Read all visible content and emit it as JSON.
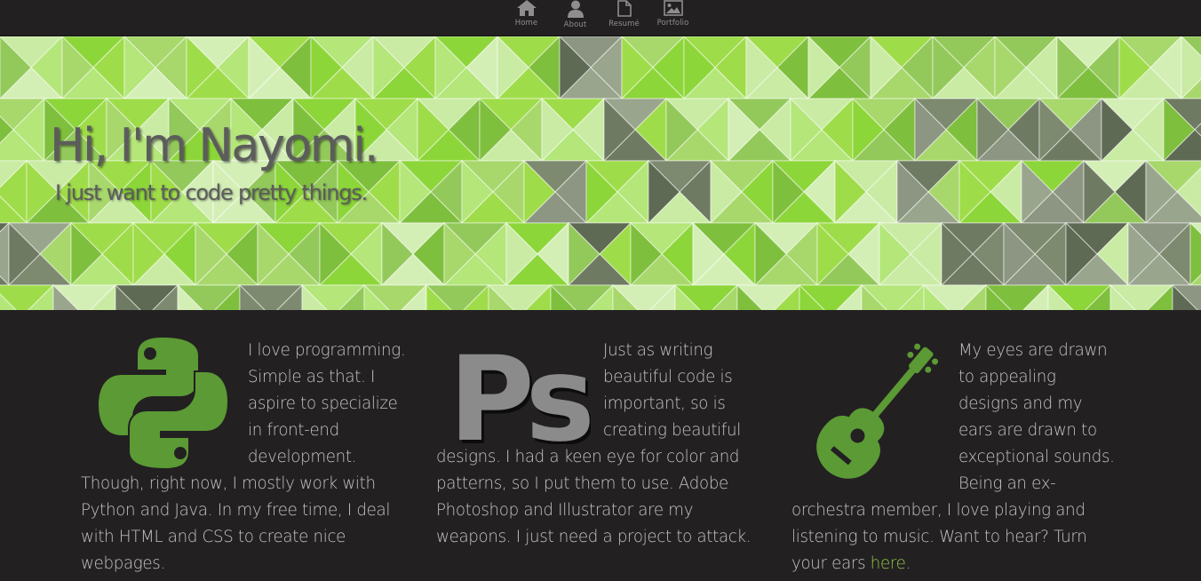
{
  "nav": {
    "items": [
      {
        "label": "Home",
        "icon": "home-icon"
      },
      {
        "label": "About",
        "icon": "user-icon"
      },
      {
        "label": "Resumé",
        "icon": "document-icon"
      },
      {
        "label": "Portfolio",
        "icon": "picture-icon"
      }
    ]
  },
  "hero": {
    "title": "Hi, I'm Nayomi.",
    "subtitle": "I just want to code pretty things."
  },
  "columns": [
    {
      "icon": "python-logo-icon",
      "text": "I love programming. Simple as that. I aspire to specialize in front-end development. Though, right now, I mostly work with Python and Java. In my free time, I deal with HTML and CSS to create nice webpages."
    },
    {
      "icon": "photoshop-logo-icon",
      "icon_text": "Ps",
      "text": "Just as writing beautiful code is important, so is creating beautiful designs. I had a keen eye for color and patterns, so I put them to use. Adobe Photoshop and Illustrator are my weapons. I just need a project to attack."
    },
    {
      "icon": "ukulele-icon",
      "text": "My eyes are drawn to appealing designs and my ears are drawn to exceptional sounds. Being an ex-orchestra member, I love playing and listening to music. Want to hear? Turn your ears ",
      "link_text": "here",
      "text_end": "."
    }
  ],
  "colors": {
    "background": "#232022",
    "accent": "#8ec543",
    "text": "#c4c4c4",
    "icon_green": "#5b9a34",
    "ps_gray": "#8b8b8b"
  }
}
